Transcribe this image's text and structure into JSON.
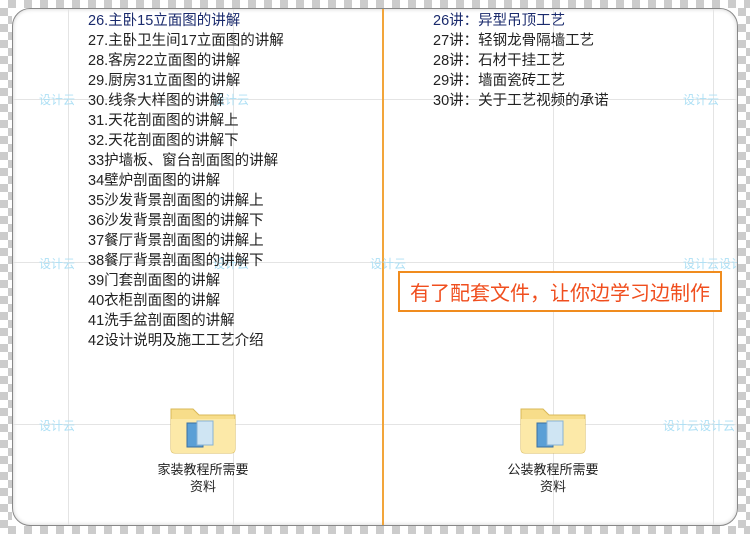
{
  "left_list": [
    "26.主卧15立面图的讲解",
    "27.主卧卫生间17立面图的讲解",
    "28.客房22立面图的讲解",
    "29.厨房31立面图的讲解",
    "30.线条大样图的讲解",
    "31.天花剖面图的讲解上",
    "32.天花剖面图的讲解下",
    "33护墙板、窗台剖面图的讲解",
    "34壁炉剖面图的讲解",
    "35沙发背景剖面图的讲解上",
    "36沙发背景剖面图的讲解下",
    "37餐厅背景剖面图的讲解上",
    "38餐厅背景剖面图的讲解下",
    "39门套剖面图的讲解",
    "40衣柜剖面图的讲解",
    "41洗手盆剖面图的讲解",
    "42设计说明及施工工艺介绍"
  ],
  "right_list": [
    "26讲：异型吊顶工艺",
    "27讲：轻钢龙骨隔墙工艺",
    "28讲：石材干挂工艺",
    "29讲：墙面瓷砖工艺",
    "30讲：关于工艺视频的承诺"
  ],
  "promo_text": "有了配套文件，让你边学习边制作",
  "folder_left": {
    "line1": "家装教程所需要",
    "line2": "资料"
  },
  "folder_right": {
    "line1": "公装教程所需要",
    "line2": "资料"
  },
  "watermark": "设计云",
  "watermark_double": "设计云设计云"
}
